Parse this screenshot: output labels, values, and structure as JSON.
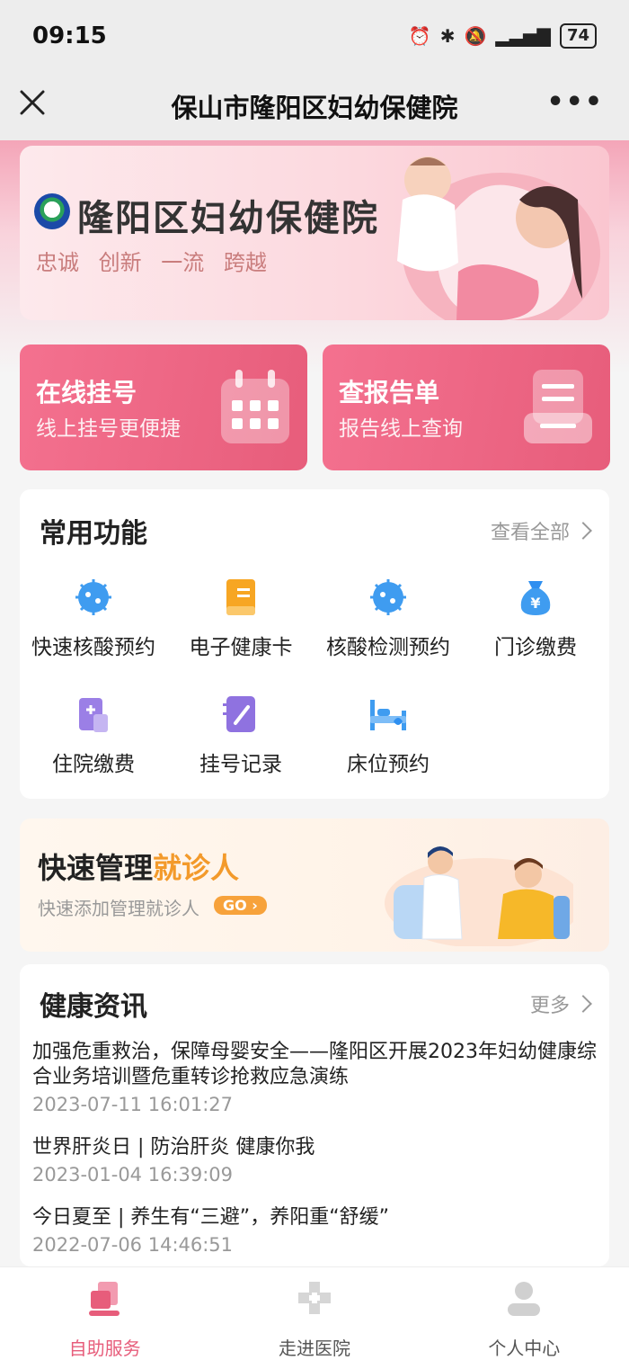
{
  "status_bar": {
    "time": "09:15",
    "battery": "74"
  },
  "nav": {
    "title": "保山市隆阳区妇幼保健院"
  },
  "banner": {
    "hospital_name": "隆阳区妇幼保健院",
    "slogan": "忠诚 创新 一流 跨越"
  },
  "quick_cards": [
    {
      "title": "在线挂号",
      "subtitle": "线上挂号更便捷"
    },
    {
      "title": "查报告单",
      "subtitle": "报告线上查询"
    }
  ],
  "functions": {
    "title": "常用功能",
    "more": "查看全部",
    "items": [
      {
        "label": "快速核酸预约",
        "icon": "virus-icon"
      },
      {
        "label": "电子健康卡",
        "icon": "health-card-icon"
      },
      {
        "label": "核酸检测预约",
        "icon": "virus-icon"
      },
      {
        "label": "门诊缴费",
        "icon": "money-bag-icon"
      },
      {
        "label": "住院缴费",
        "icon": "hospital-bill-icon"
      },
      {
        "label": "挂号记录",
        "icon": "notebook-pen-icon"
      },
      {
        "label": "床位预约",
        "icon": "bed-icon"
      }
    ]
  },
  "patient": {
    "title_main": "快速管理",
    "title_highlight": "就诊人",
    "subtitle": "快速添加管理就诊人",
    "go": "GO"
  },
  "news": {
    "title": "健康资讯",
    "more": "更多",
    "items": [
      {
        "title": "加强危重救治，保障母婴安全——隆阳区开展2023年妇幼健康综合业务培训暨危重转诊抢救应急演练",
        "date": "2023-07-11 16:01:27"
      },
      {
        "title": "世界肝炎日 | 防治肝炎 健康你我",
        "date": "2023-01-04 16:39:09"
      },
      {
        "title": "今日夏至 | 养生有“三避”，养阳重“舒缓”",
        "date": "2022-07-06 14:46:51"
      }
    ]
  },
  "tabbar": [
    {
      "label": "自助服务",
      "active": true
    },
    {
      "label": "走进医院",
      "active": false
    },
    {
      "label": "个人中心",
      "active": false
    }
  ],
  "colors": {
    "accent": "#e75d7b",
    "highlight": "#f39a2b",
    "icon_blue": "#3f9cf0"
  }
}
